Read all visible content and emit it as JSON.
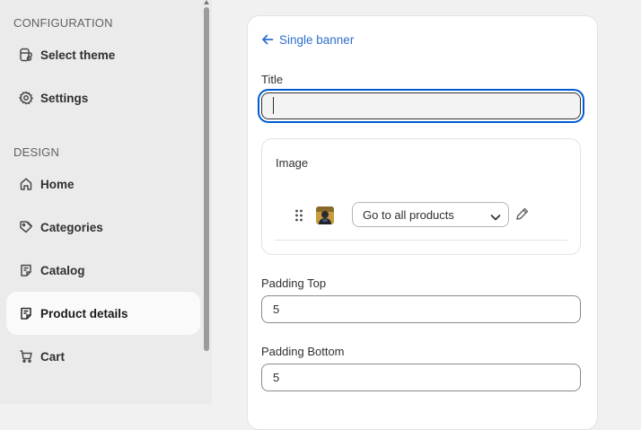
{
  "sidebar": {
    "sections": [
      {
        "label": "CONFIGURATION"
      },
      {
        "label": "DESIGN"
      }
    ],
    "items": [
      {
        "label": "Select theme",
        "icon": "theme-icon"
      },
      {
        "label": "Settings",
        "icon": "gear-icon"
      },
      {
        "label": "Home",
        "icon": "home-icon"
      },
      {
        "label": "Categories",
        "icon": "tag-icon"
      },
      {
        "label": "Catalog",
        "icon": "catalog-icon"
      },
      {
        "label": "Product details",
        "icon": "product-details-icon",
        "active": true
      },
      {
        "label": "Cart",
        "icon": "cart-icon"
      }
    ]
  },
  "editor": {
    "back_label": "Single banner",
    "title_label": "Title",
    "title_value": "",
    "image_card": {
      "title": "Image",
      "link_select_value": "Go to all products"
    },
    "padding_top_label": "Padding Top",
    "padding_top_value": "5",
    "padding_bottom_label": "Padding Bottom",
    "padding_bottom_value": "5"
  },
  "colors": {
    "accent": "#2c6ecb",
    "focus_ring": "#005bd3",
    "active_item_bg": "#fafafa",
    "sidebar_bg": "#ebebeb"
  }
}
